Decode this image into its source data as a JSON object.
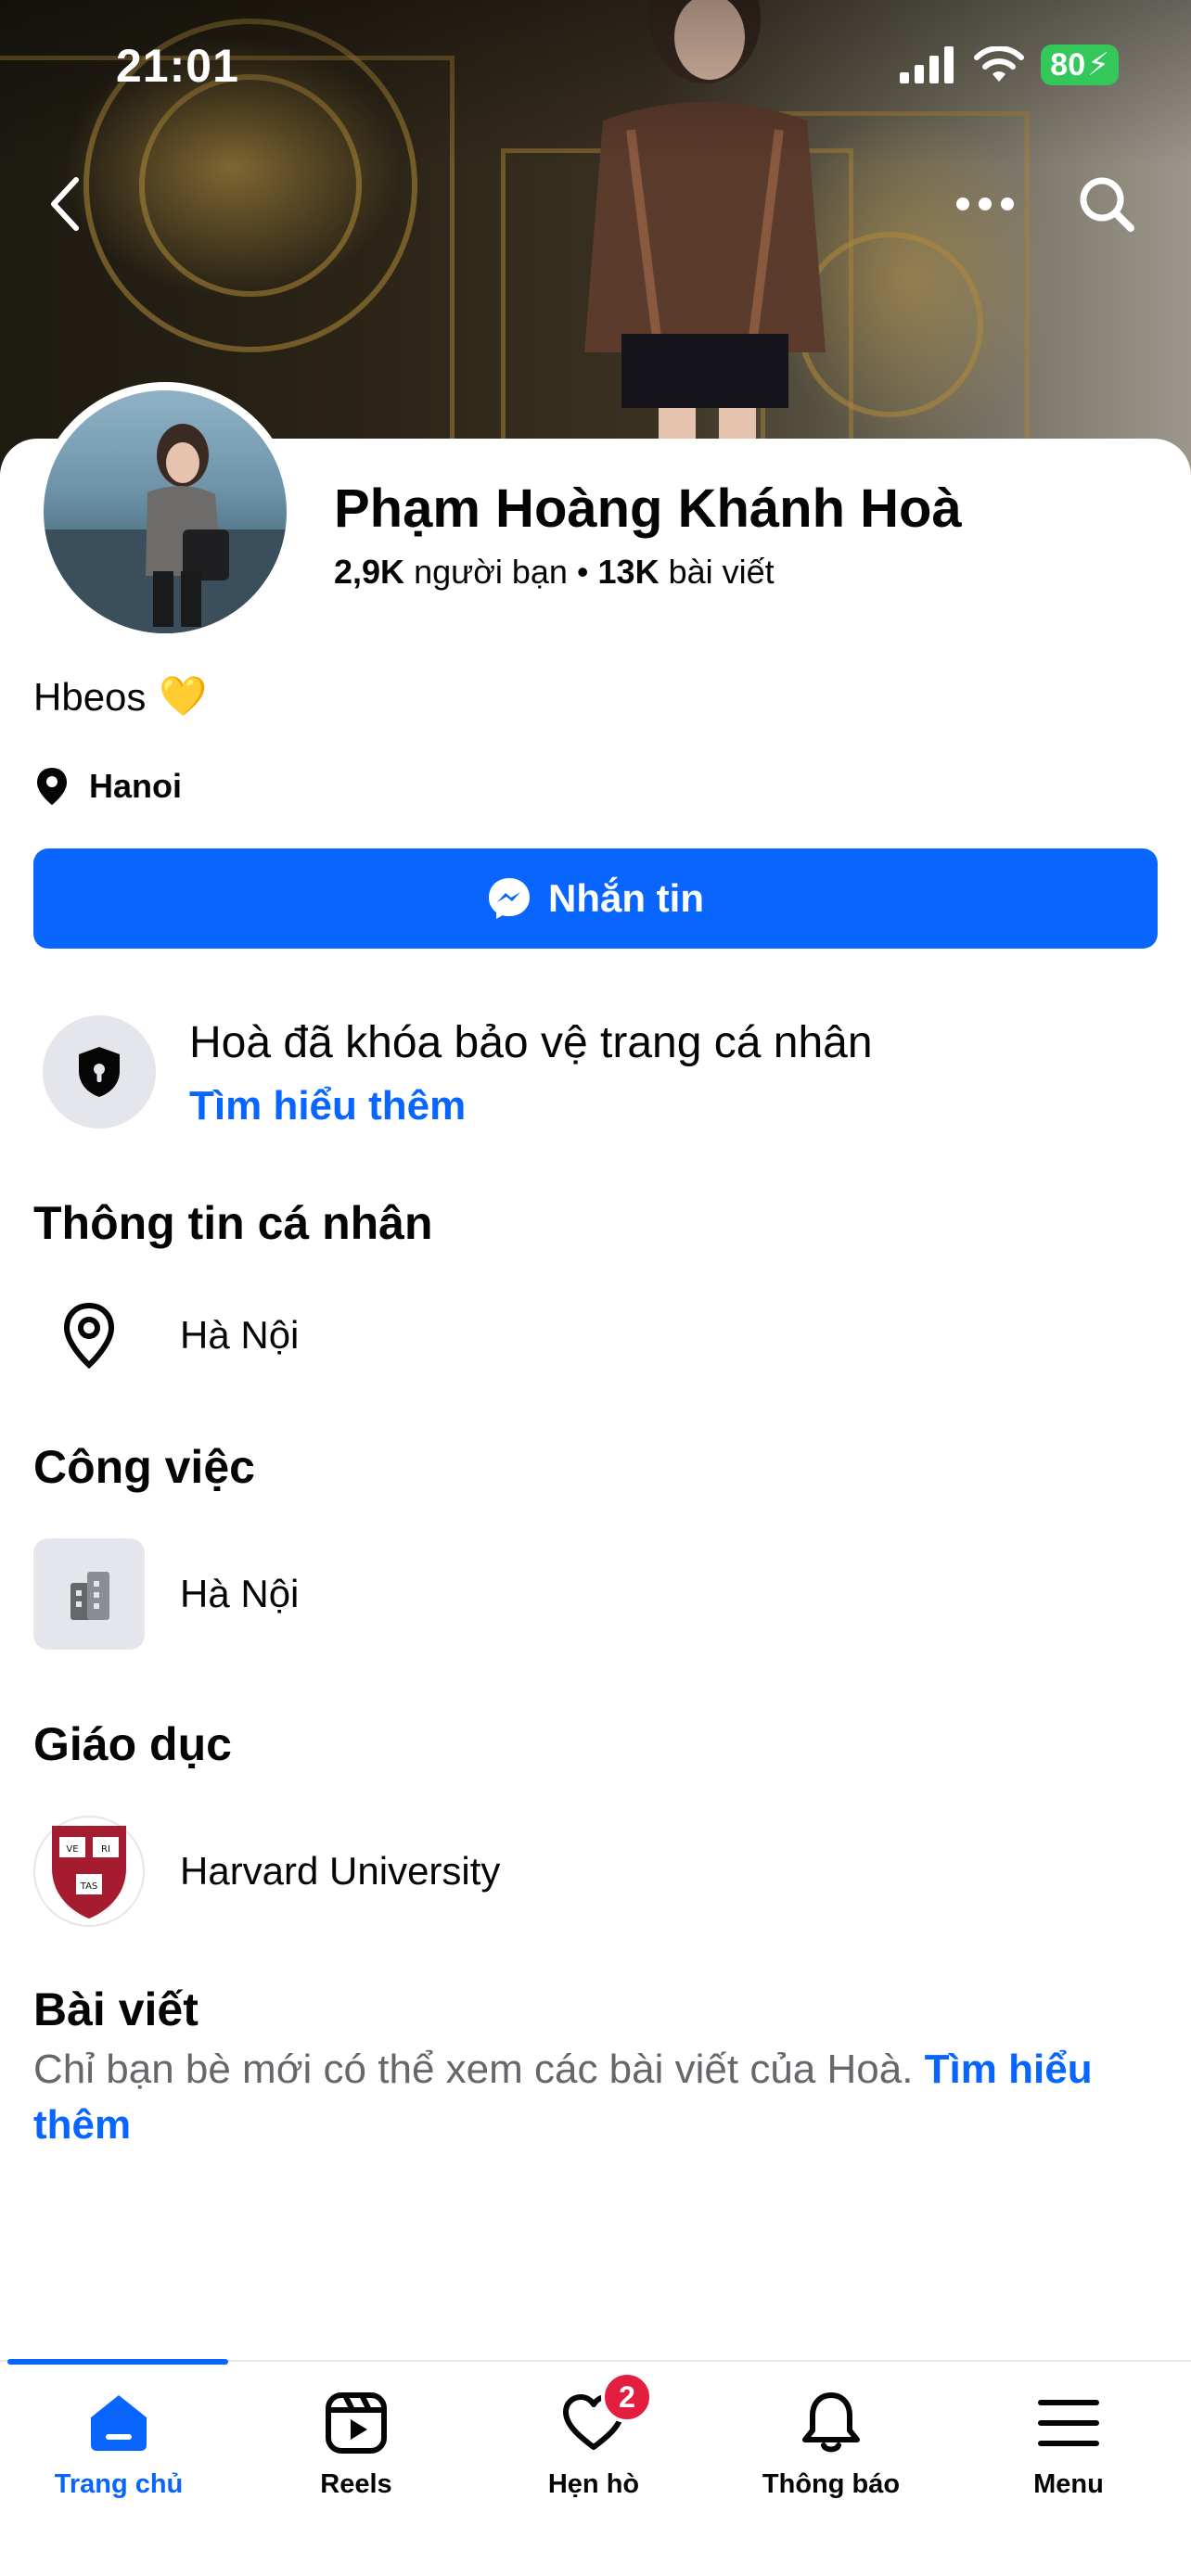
{
  "status_bar": {
    "time": "21:01",
    "battery": "80"
  },
  "profile": {
    "name": "Phạm Hoàng Khánh Hoà",
    "friends_count": "2,9K",
    "friends_label": "người bạn",
    "separator": "•",
    "posts_count": "13K",
    "posts_label": "bài viết",
    "bio": "Hbeos",
    "bio_emoji": "💛",
    "location": "Hanoi"
  },
  "message_button": {
    "label": "Nhắn tin"
  },
  "lock_notice": {
    "title": "Hoà đã khóa bảo vệ trang cá nhân",
    "link": "Tìm hiểu thêm"
  },
  "sections": {
    "personal_info": {
      "heading": "Thông tin cá nhân",
      "value": "Hà Nội"
    },
    "work": {
      "heading": "Công việc",
      "value": "Hà Nội"
    },
    "education": {
      "heading": "Giáo dục",
      "value": "Harvard University",
      "logo_text": [
        "VE",
        "RI",
        "TAS"
      ]
    },
    "posts": {
      "heading": "Bài viết",
      "note": "Chỉ bạn bè mới có thể xem các bài viết của Hoà.",
      "link": "Tìm hiểu thêm"
    }
  },
  "bottom_nav": [
    {
      "label": "Trang chủ",
      "icon": "home-icon",
      "active": true
    },
    {
      "label": "Reels",
      "icon": "reels-icon",
      "active": false
    },
    {
      "label": "Hẹn hò",
      "icon": "dating-heart-icon",
      "active": false,
      "badge": "2"
    },
    {
      "label": "Thông báo",
      "icon": "bell-icon",
      "active": false
    },
    {
      "label": "Menu",
      "icon": "menu-icon",
      "active": false
    }
  ],
  "colors": {
    "accent": "#0866ff",
    "badge": "#e41e3f",
    "muted_text": "#65676b",
    "chip_bg": "#e4e6eb"
  }
}
